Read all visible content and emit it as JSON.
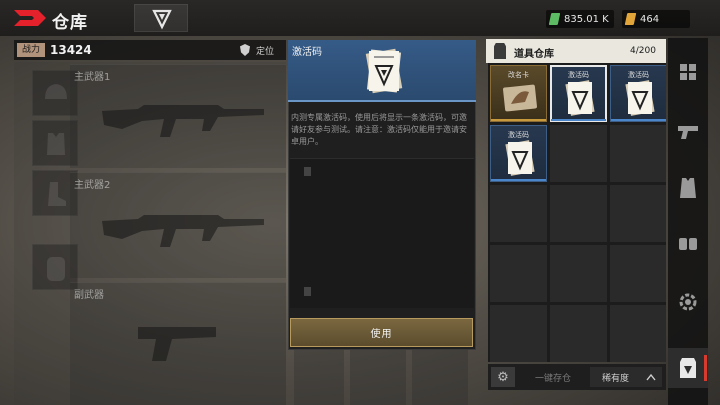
{
  "header": {
    "title": "仓库",
    "logo_icon": "red-d-logo-icon",
    "filter_icon": "v-logo-icon"
  },
  "currencies": [
    {
      "name": "green-currency",
      "icon": "green-bill-icon",
      "value": "835.01 K",
      "color": "#5dbb63"
    },
    {
      "name": "gold-currency",
      "icon": "gold-bill-icon",
      "value": "464",
      "color": "#e2a53a"
    }
  ],
  "loadout": {
    "power_label": "战力",
    "power_value": "13424",
    "locate_label": "定位",
    "slots": [
      {
        "label": "主武器1"
      },
      {
        "label": "主武器2"
      },
      {
        "label": "副武器"
      }
    ]
  },
  "popup": {
    "title": "激活码",
    "description": "内测专属激活码，使用后将显示一条激活码，可邀请好友参与测试。请注意：激活码仅能用于邀请安卓用户。",
    "use_button": "使用"
  },
  "inventory": {
    "title": "道具仓库",
    "count": "4/200",
    "items": [
      {
        "name": "改名卡",
        "rarity": "gold",
        "selected": false
      },
      {
        "name": "激活码",
        "rarity": "blue",
        "selected": true
      },
      {
        "name": "激活码",
        "rarity": "blue",
        "selected": false
      },
      {
        "name": "激活码",
        "rarity": "blue",
        "selected": false
      }
    ],
    "empty_cells": 11,
    "store_all_label": "一键存仓",
    "sort_label": "稀有度"
  },
  "sidebar": {
    "tabs": [
      "grid-icon",
      "pistol-icon",
      "vest-icon",
      "ammo-icon",
      "gear-icon",
      "bag-icon"
    ],
    "active_tab": "bag-icon",
    "accent_color": "#d73a2e"
  }
}
